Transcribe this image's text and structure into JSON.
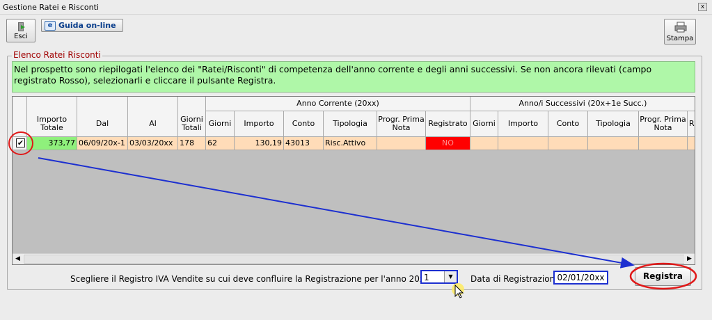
{
  "window": {
    "title": "Gestione Ratei e Risconti",
    "close": "x"
  },
  "toolbar": {
    "esci": "Esci",
    "guida": "Guida on-line",
    "stampa": "Stampa"
  },
  "group": {
    "title": "Elenco Ratei Risconti"
  },
  "info": "Nel prospetto sono riepilogati l'elenco dei \"Ratei/Risconti\" di competenza dell'anno corrente e degli anni successivi. Se non ancora rilevati (campo registrato Rosso), selezionarli e cliccare il pulsante Registra.",
  "grid": {
    "group_headers": {
      "corrente": "Anno Corrente (20xx)",
      "successivi": "Anno/i Successivi (20x+1e Succ.)"
    },
    "columns": {
      "importo_totale": "Importo Totale",
      "dal": "Dal",
      "al": "Al",
      "giorni_totali": "Giorni Totali",
      "giorni": "Giorni",
      "importo": "Importo",
      "conto": "Conto",
      "tipologia": "Tipologia",
      "progr": "Progr. Prima Nota",
      "registrato": "Registrato",
      "s_giorni": "Giorni",
      "s_importo": "Importo",
      "s_conto": "Conto",
      "s_tipologia": "Tipologia",
      "s_progr": "Progr. Prima Nota",
      "s_r": "R"
    },
    "row": {
      "checked": "✔",
      "importo_totale": "373,77",
      "dal": "06/09/20x-1",
      "al": "03/03/20xx",
      "giorni_totali": "178",
      "giorni": "62",
      "importo": "130,19",
      "conto": "43013",
      "tipologia": "Risc.Attivo",
      "progr": "",
      "registrato": "NO"
    }
  },
  "footer": {
    "registro_label": "Scegliere il Registro IVA Vendite su cui deve confluire la Registrazione per l'anno 20xx",
    "registro_value": "1",
    "data_label": "Data di Registrazione:",
    "data_value": "02/01/20xx",
    "registra": "Registra"
  },
  "colors": {
    "info_bg": "#aff7a8",
    "highlight": "#ff0000",
    "arrow": "#1c2fd0",
    "peach": "#ffdcb8"
  }
}
